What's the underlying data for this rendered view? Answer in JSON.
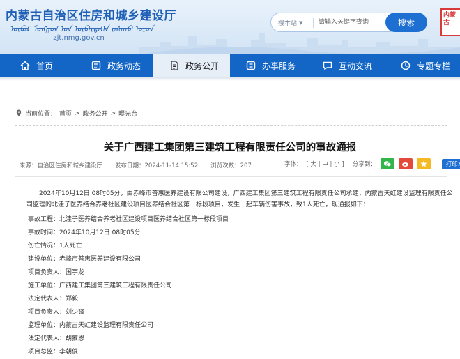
{
  "site": {
    "title": "内蒙古自治区住房和城乡建设厅",
    "mongolian": "ᠥᠪᠦᠷ ᠮᠣᠩᠭᠣᠯ ᠤᠨ ᠥᠪᠡᠷᠲᠡᠭᠡᠨ ᠵᠠᠰᠠᠬᠤ ᠣᠷᠣᠨ",
    "domain": "zjt.nmg.gov.cn",
    "seal_text": "内蒙古"
  },
  "search": {
    "scope": "搜本站",
    "placeholder": "请输入关键字查询",
    "button": "搜索"
  },
  "nav": {
    "items": [
      {
        "label": "首页",
        "icon": "home-icon"
      },
      {
        "label": "政务动态",
        "icon": "news-icon"
      },
      {
        "label": "政务公开",
        "icon": "document-icon",
        "active": true
      },
      {
        "label": "办事服务",
        "icon": "service-icon"
      },
      {
        "label": "互动交流",
        "icon": "chat-icon"
      },
      {
        "label": "专题专栏",
        "icon": "topic-icon"
      }
    ]
  },
  "breadcrumb": {
    "prefix": "当前位置：",
    "items": [
      "首页",
      "政务公开",
      "曝光台"
    ],
    "separator": ">"
  },
  "article": {
    "title": "关于广西建工集团第三建筑工程有限责任公司的事故通报",
    "source": "来源：自治区住房和城乡建设厅",
    "date": "发布日期：2024-11-14 15:52",
    "views": "浏览次数：207",
    "font_label": "字体：",
    "font_sizes": [
      "大",
      "中",
      "小"
    ],
    "share_label": "分享到：",
    "print": "打印本页",
    "lead": "2024年10月12日 08时05分，由赤峰市普惠医养建设有限公司建设，广西建工集团第三建筑工程有限责任公司承建，内蒙古天虹建设监理有限责任公司监理的北洼子医养结合养老社区建设项目医养结合社区第一标段项目，发生一起车辆伤害事故，致1人死亡，现通报如下：",
    "fields": [
      "事故工程：北洼子医养结合养老社区建设项目医养结合社区第一标段项目",
      "事故时间：2024年10月12日 08时05分",
      "伤亡情况：1人死亡",
      "建设单位：赤峰市普惠医养建设有限公司",
      "项目负责人：国宇龙",
      "施工单位：广西建工集团第三建筑工程有限责任公司",
      "法定代表人：郑毅",
      "项目负责人：刘少锋",
      "监理单位：内蒙古天虹建设监理有限责任公司",
      "法定代表人：胡蒙恩",
      "项目总监：李朝俊"
    ]
  },
  "colors": {
    "nav_bg": "#1466c6",
    "accent": "#1e6fd2",
    "title_blue": "#1f5fb5"
  }
}
